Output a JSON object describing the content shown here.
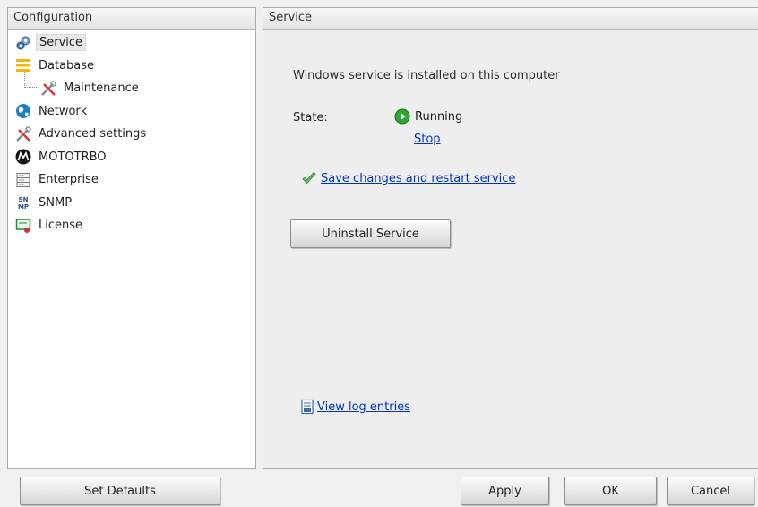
{
  "left_panel": {
    "title": "Configuration",
    "items": [
      {
        "label": "Service",
        "icon": "gears-icon",
        "selected": true
      },
      {
        "label": "Database",
        "icon": "database-icon"
      },
      {
        "label": "Maintenance",
        "icon": "tools-icon",
        "child": true
      },
      {
        "label": "Network",
        "icon": "globe-icon"
      },
      {
        "label": "Advanced settings",
        "icon": "tools-icon"
      },
      {
        "label": "MOTOTRBO",
        "icon": "motorola-logo-icon"
      },
      {
        "label": "Enterprise",
        "icon": "server-rack-icon"
      },
      {
        "label": "SNMP",
        "icon": "snmp-icon"
      },
      {
        "label": "License",
        "icon": "license-certificate-icon"
      }
    ]
  },
  "right_panel": {
    "title": "Service",
    "info_text": "Windows service is installed on this computer",
    "state_label": "State:",
    "state_value": "Running",
    "stop_link": "Stop",
    "save_link": "Save changes and restart service",
    "uninstall_button": "Uninstall Service",
    "log_link": "View log entries"
  },
  "footer": {
    "set_defaults": "Set Defaults",
    "apply": "Apply",
    "ok": "OK",
    "cancel": "Cancel"
  },
  "colors": {
    "link": "#0033cc",
    "running_green": "#2ea82e",
    "check_green": "#5cb85c"
  }
}
